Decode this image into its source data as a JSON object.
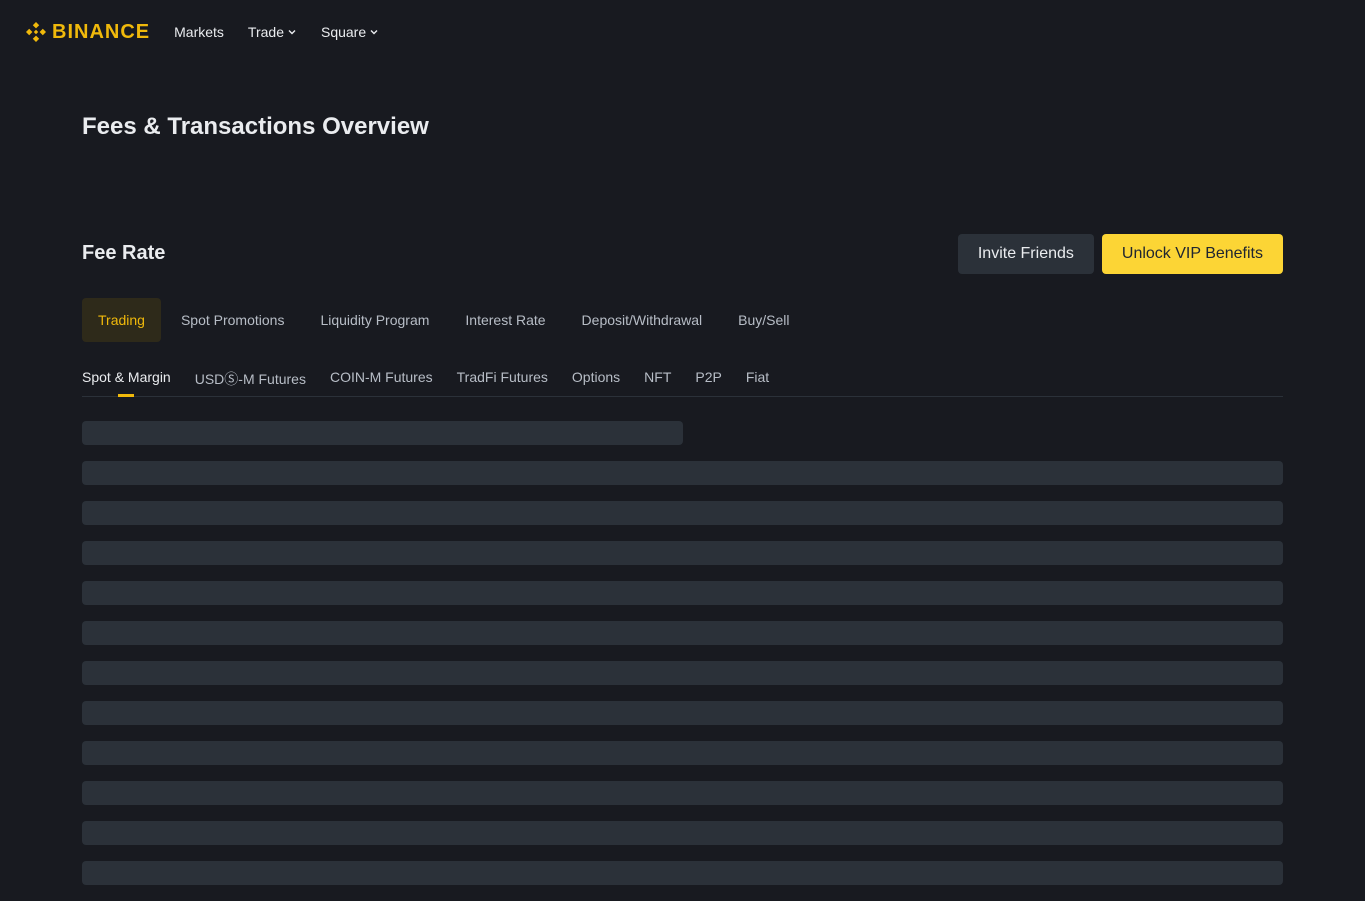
{
  "brand": {
    "name": "BINANCE",
    "color": "#f0b90b"
  },
  "nav": {
    "items": [
      {
        "label": "Markets",
        "dropdown": false
      },
      {
        "label": "Trade",
        "dropdown": true
      },
      {
        "label": "Square",
        "dropdown": true
      }
    ]
  },
  "page": {
    "title": "Fees & Transactions Overview"
  },
  "fee_rate": {
    "title": "Fee Rate",
    "invite_label": "Invite Friends",
    "vip_label": "Unlock VIP Benefits"
  },
  "primary_tabs": [
    {
      "label": "Trading",
      "active": true
    },
    {
      "label": "Spot Promotions",
      "active": false
    },
    {
      "label": "Liquidity Program",
      "active": false
    },
    {
      "label": "Interest Rate",
      "active": false
    },
    {
      "label": "Deposit/Withdrawal",
      "active": false
    },
    {
      "label": "Buy/Sell",
      "active": false
    }
  ],
  "sub_tabs": [
    {
      "label": "Spot & Margin",
      "active": true
    },
    {
      "label": "USDⓈ-M Futures",
      "active": false
    },
    {
      "label": "COIN-M Futures",
      "active": false
    },
    {
      "label": "TradFi Futures",
      "active": false
    },
    {
      "label": "Options",
      "active": false
    },
    {
      "label": "NFT",
      "active": false
    },
    {
      "label": "P2P",
      "active": false
    },
    {
      "label": "Fiat",
      "active": false
    }
  ],
  "colors": {
    "background": "#181a20",
    "accent": "#f0b90b",
    "primary_button": "#fcd535",
    "secondary_button": "#2b3139",
    "skeleton": "#2b3139"
  }
}
